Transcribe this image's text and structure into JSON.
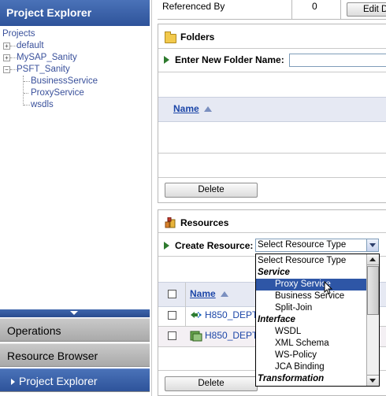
{
  "sidebar": {
    "title": "Project Explorer",
    "tree": {
      "root": "Projects",
      "items": [
        "default",
        "MySAP_Sanity",
        "PSFT_Sanity"
      ],
      "children": [
        "BusinessService",
        "ProxyService",
        "wsdls"
      ]
    },
    "nav": [
      "Operations",
      "Resource Browser",
      "Project Explorer"
    ]
  },
  "references": {
    "label": "Referenced By",
    "count": "0",
    "edit_button": "Edit D"
  },
  "folders": {
    "title": "Folders",
    "new_folder_label": "Enter New Folder Name:",
    "new_folder_value": "",
    "column_name": "Name",
    "delete_button": "Delete"
  },
  "resources": {
    "title": "Resources",
    "create_label": "Create Resource:",
    "select_value": "Select Resource Type",
    "column_name": "Name",
    "rows": [
      "H850_DEPT",
      "H850_DEPT"
    ],
    "delete_button": "Delete",
    "dropdown": [
      {
        "text": "Select Resource Type",
        "kind": "first"
      },
      {
        "text": "Service",
        "kind": "group"
      },
      {
        "text": "Proxy Service",
        "kind": "option",
        "selected": true
      },
      {
        "text": "Business Service",
        "kind": "option"
      },
      {
        "text": "Split-Join",
        "kind": "option"
      },
      {
        "text": "Interface",
        "kind": "group"
      },
      {
        "text": "WSDL",
        "kind": "option"
      },
      {
        "text": "XML Schema",
        "kind": "option"
      },
      {
        "text": "WS-Policy",
        "kind": "option"
      },
      {
        "text": "JCA Binding",
        "kind": "option"
      },
      {
        "text": "Transformation",
        "kind": "group"
      }
    ]
  },
  "colors": {
    "nav_blue": "#2e539a",
    "link_blue": "#1c46a8",
    "highlight": "#2e56a6"
  }
}
